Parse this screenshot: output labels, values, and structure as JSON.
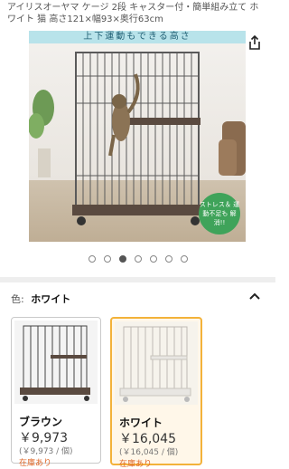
{
  "product": {
    "title": "アイリスオーヤマ ケージ 2段 キャスター付・簡単組み立て ホワイト 猫 高さ121×幅93×奥行63cm"
  },
  "gallery": {
    "banner_text": "上下運動もできる高さ",
    "badge_text": "ストレス＆ 運動不足も 解消!!",
    "dots_total": 7,
    "active_index": 2
  },
  "variation": {
    "label": "色:",
    "selected": "ホワイト",
    "options": [
      {
        "name": "ブラウン",
        "price": "￥9,973",
        "unit_price": "(￥9,973 / 個)",
        "stock": "在庫あり"
      },
      {
        "name": "ホワイト",
        "price": "￥16,045",
        "unit_price": "(￥16,045 / 個)",
        "stock": "在庫あり"
      }
    ]
  },
  "colors": {
    "banner_bg": "#b8e3ea",
    "badge_bg": "#3fa35a",
    "selected_border": "#f3b23a",
    "cage_brown": "#5a4a40",
    "cage_white": "#e8e6e2"
  }
}
